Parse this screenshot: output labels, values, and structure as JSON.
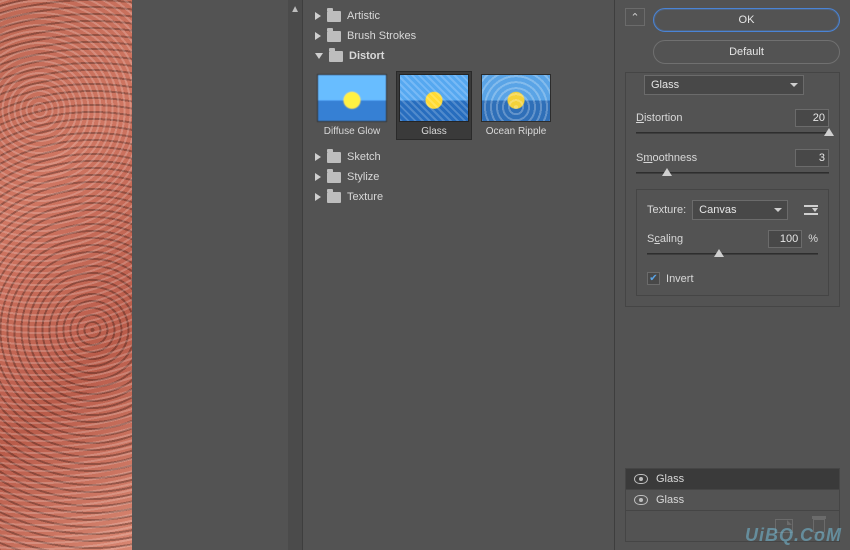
{
  "buttons": {
    "ok": "OK",
    "default": "Default"
  },
  "categories": {
    "artistic": "Artistic",
    "brush_strokes": "Brush Strokes",
    "distort": "Distort",
    "sketch": "Sketch",
    "stylize": "Stylize",
    "texture": "Texture"
  },
  "distort_thumbs": {
    "diffuse_glow": "Diffuse Glow",
    "glass": "Glass",
    "ocean_ripple": "Ocean Ripple"
  },
  "filter_select": {
    "selected": "Glass"
  },
  "params": {
    "distortion": {
      "label": "Distortion",
      "value": "20",
      "pos": 100
    },
    "smoothness": {
      "label": "Smoothness",
      "value": "3",
      "pos": 16
    },
    "texture_label": "Texture:",
    "texture_selected": "Canvas",
    "scaling": {
      "label": "Scaling",
      "value": "100",
      "unit": "%",
      "pos": 42
    },
    "invert": {
      "label": "Invert",
      "checked": true
    }
  },
  "layers": [
    {
      "name": "Glass",
      "selected": true,
      "visible": true
    },
    {
      "name": "Glass",
      "selected": false,
      "visible": true
    }
  ],
  "watermark": "UiBQ.CoM"
}
